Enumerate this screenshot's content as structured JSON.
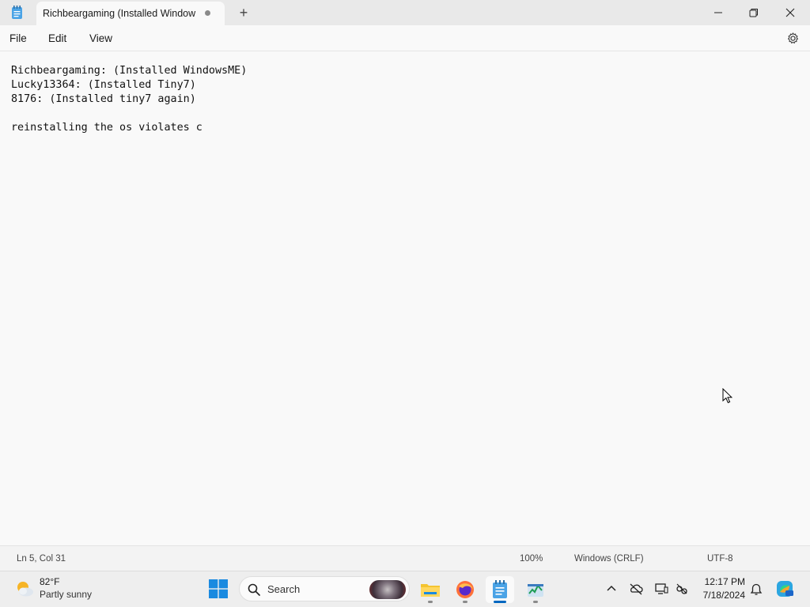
{
  "window": {
    "tab_title": "Richbeargaming (Installed Window",
    "new_tab": "+"
  },
  "menu": {
    "file": "File",
    "edit": "Edit",
    "view": "View"
  },
  "editor": {
    "lines": [
      "Richbeargaming: (Installed WindowsME)",
      "Lucky13364: (Installed Tiny7)",
      "8176: (Installed tiny7 again)",
      "",
      "reinstalling the os violates c"
    ]
  },
  "status": {
    "position": "Ln 5, Col 31",
    "zoom": "100%",
    "line_endings": "Windows (CRLF)",
    "encoding": "UTF-8"
  },
  "taskbar": {
    "weather_temp": "82°F",
    "weather_desc": "Partly sunny",
    "search_placeholder": "Search",
    "time": "12:17 PM",
    "date": "7/18/2024",
    "apps": [
      "file-explorer-icon",
      "firefox-icon",
      "notepad-icon",
      "task-manager-icon"
    ]
  },
  "colors": {
    "accent": "#0067c0",
    "explorer_yellow": "#f4c430",
    "firefox_orange": "#ff7139"
  }
}
